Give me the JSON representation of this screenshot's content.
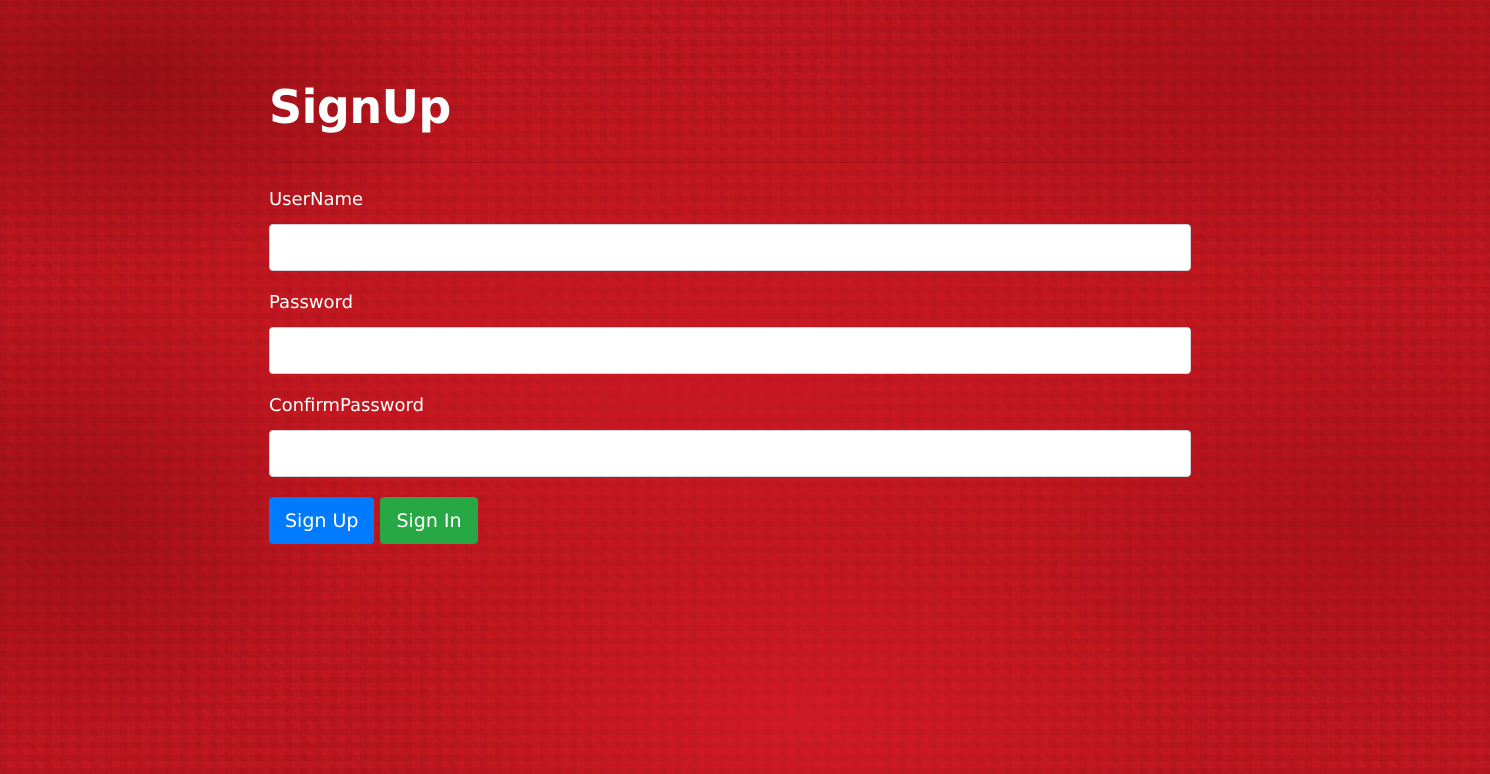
{
  "page": {
    "title": "SignUp"
  },
  "form": {
    "fields": [
      {
        "label": "UserName",
        "value": "",
        "placeholder": ""
      },
      {
        "label": "Password",
        "value": "",
        "placeholder": ""
      },
      {
        "label": "ConfirmPassword",
        "value": "",
        "placeholder": ""
      }
    ],
    "buttons": {
      "signup_label": "Sign Up",
      "signin_label": "Sign In"
    }
  },
  "colors": {
    "background": "#c0161f",
    "primary_button": "#007bff",
    "success_button": "#28a745",
    "text": "#ffffff"
  }
}
